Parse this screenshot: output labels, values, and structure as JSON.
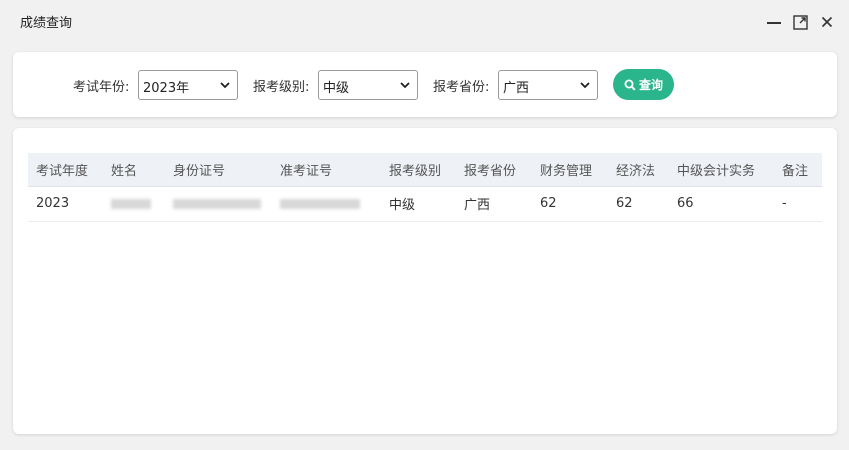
{
  "window": {
    "title": "成绩查询",
    "controls": {
      "minimize_icon": "minimize-icon",
      "maximize_icon": "maximize-icon",
      "close_icon": "close-icon"
    }
  },
  "filters": {
    "year": {
      "label": "考试年份:",
      "value": "2023年"
    },
    "level": {
      "label": "报考级别:",
      "value": "中级"
    },
    "province": {
      "label": "报考省份:",
      "value": "广西"
    },
    "search_button": {
      "label": "查询",
      "icon": "search-icon",
      "color": "#2bb58c"
    }
  },
  "table": {
    "columns": [
      "考试年度",
      "姓名",
      "身份证号",
      "准考证号",
      "报考级别",
      "报考省份",
      "财务管理",
      "经济法",
      "中级会计实务",
      "备注"
    ],
    "rows": [
      {
        "year": "2023",
        "level": "中级",
        "province": "广西",
        "finance": "62",
        "law": "62",
        "accounting": "66",
        "note": "-"
      }
    ]
  }
}
